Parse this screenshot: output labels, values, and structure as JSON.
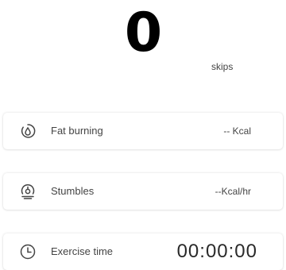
{
  "counter": {
    "value": "0",
    "unit": "skips"
  },
  "stats": [
    {
      "label": "Fat burning",
      "value": "-- Kcal",
      "icon": "flame-drop-icon"
    },
    {
      "label": "Stumbles",
      "value": "--Kcal/hr",
      "icon": "stumble-icon"
    },
    {
      "label": "Exercise time",
      "value": "00:00:00",
      "icon": "clock-icon"
    }
  ],
  "colors": {
    "text": "#444444",
    "counter": "#000000",
    "card_background": "#ffffff"
  }
}
